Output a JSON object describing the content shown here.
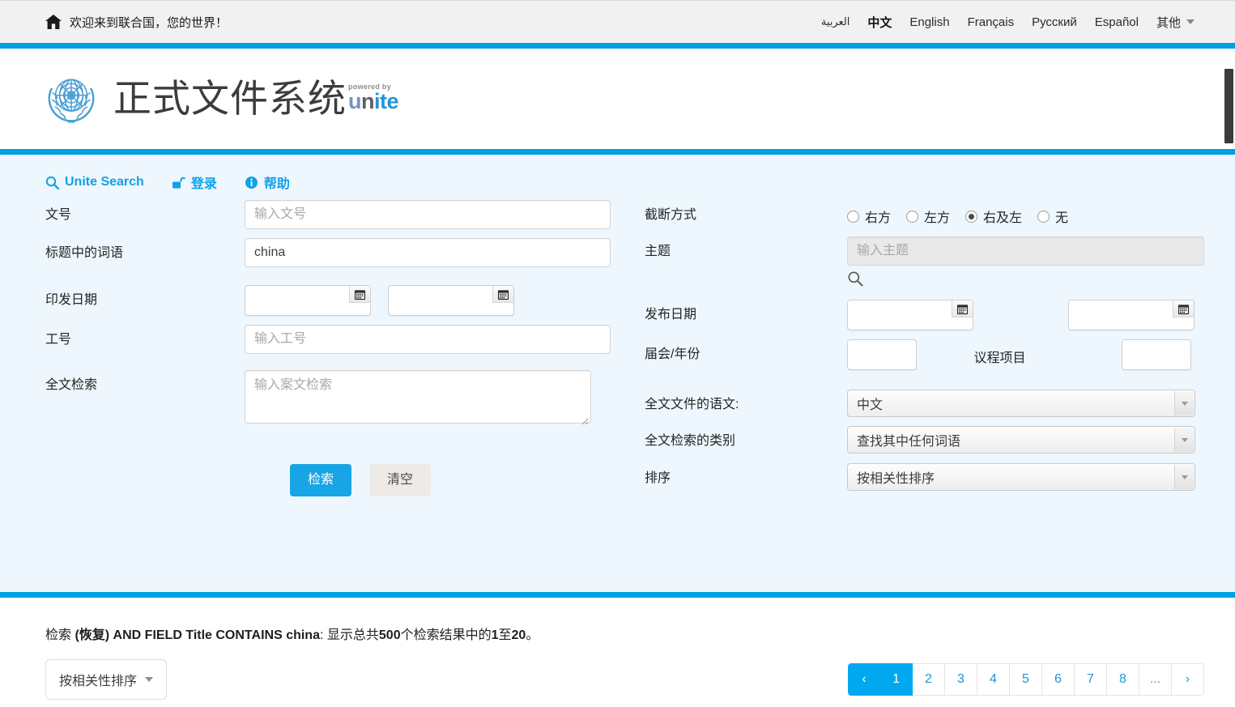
{
  "topbar": {
    "home_icon": "home-icon",
    "home_text": "欢迎来到联合国，您的世界！",
    "languages": [
      {
        "label": "العربية",
        "active": false
      },
      {
        "label": "中文",
        "active": true
      },
      {
        "label": "English",
        "active": false
      },
      {
        "label": "Français",
        "active": false
      },
      {
        "label": "Русский",
        "active": false
      },
      {
        "label": "Español",
        "active": false
      }
    ],
    "more_label": "其他",
    "more_icon": "chevron-down-icon"
  },
  "brand": {
    "emblem_icon": "un-emblem-icon",
    "title": "正式文件系统",
    "powered_by": "powered by",
    "unite_u": "u",
    "unite_n": "n",
    "unite_ite": "ite"
  },
  "quicklinks": [
    {
      "label": "Unite Search",
      "icon": "search-icon"
    },
    {
      "label": "登录",
      "icon": "unlock-icon"
    },
    {
      "label": "帮助",
      "icon": "info-icon"
    }
  ],
  "form": {
    "symbol": {
      "label": "文号",
      "placeholder": "输入文号",
      "value": ""
    },
    "title_words": {
      "label": "标题中的词语",
      "placeholder": "",
      "value": "china"
    },
    "publication_date": {
      "label": "印发日期",
      "from_value": "",
      "to_value": "",
      "calendar_icon": "calendar-icon"
    },
    "job_number": {
      "label": "工号",
      "placeholder": "输入工号",
      "value": ""
    },
    "fulltext": {
      "label": "全文检索",
      "placeholder": "输入案文检索",
      "value": ""
    },
    "truncation": {
      "label": "截断方式",
      "options": [
        {
          "label": "右方",
          "checked": false
        },
        {
          "label": "左方",
          "checked": false
        },
        {
          "label": "右及左",
          "checked": true
        },
        {
          "label": "无",
          "checked": false
        }
      ]
    },
    "subject": {
      "label": "主题",
      "placeholder": "输入主题",
      "value": "",
      "disabled": true,
      "lookup_icon": "search-icon"
    },
    "release_date": {
      "label": "发布日期",
      "from_value": "",
      "to_value": "",
      "calendar_icon": "calendar-icon"
    },
    "session_year": {
      "label": "届会/年份",
      "value": ""
    },
    "agenda_item": {
      "label": "议程项目",
      "value": ""
    },
    "fulltext_language": {
      "label": "全文文件的语文:",
      "value": "中文",
      "arrow_icon": "caret-down-icon"
    },
    "fulltext_type": {
      "label": "全文检索的类别",
      "value": "查找其中任何词语",
      "arrow_icon": "caret-down-icon"
    },
    "sort": {
      "label": "排序",
      "value": "按相关性排序",
      "arrow_icon": "caret-down-icon"
    },
    "submit_label": "检索",
    "reset_label": "清空"
  },
  "results": {
    "summary_prefix": "检索 ",
    "summary_query": "(恢复) AND FIELD Title CONTAINS china",
    "summary_mid": ": 显示总共",
    "summary_total": "500",
    "summary_mid2": "个检索结果中的",
    "summary_from": "1",
    "summary_mid3": "至",
    "summary_to": "20",
    "summary_suffix": "。",
    "sort_button_label": "按相关性排序",
    "sort_caret_icon": "caret-down-icon",
    "pagination": {
      "prev_label": "‹",
      "next_label": "›",
      "ellipsis_label": "...",
      "pages": [
        "1",
        "2",
        "3",
        "4",
        "5",
        "6",
        "7",
        "8"
      ],
      "active_page": "1"
    }
  },
  "colors": {
    "accent_blue": "#00a0e3",
    "link_blue": "#12a0e8",
    "panel_bg": "#eef7fd",
    "topbar_bg": "#f1f1f1"
  }
}
